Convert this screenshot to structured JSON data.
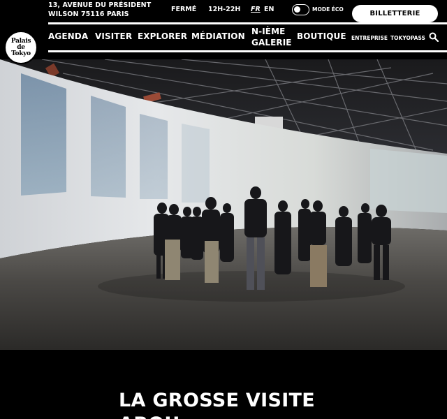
{
  "header": {
    "address": [
      "13, AVENUE DU PRÉSIDENT",
      "WILSON 75116 PARIS"
    ],
    "status": "FERMÉ",
    "hours": "12H-22H",
    "languages": [
      "FR",
      "EN"
    ],
    "active_language": "FR",
    "eco_mode_label": "MODE ÉCO",
    "ticket_label": "BILLETTERIE"
  },
  "logo": {
    "lines": [
      "Palais",
      "de",
      "Tokyo"
    ]
  },
  "nav": {
    "items": [
      "AGENDA",
      "VISITER",
      "EXPLORER",
      "MÉDIATION",
      "N-IÈME",
      "GALERIE",
      "BOUTIQUE"
    ],
    "secondary": [
      "ENTREPRISE",
      "TOKYOPASS"
    ]
  },
  "hero": {
    "title_lines": [
      "LA GROSSE VISITE",
      "ABOU"
    ]
  },
  "icons": {
    "search": "search-icon"
  },
  "colors": {
    "background": "#000000",
    "text": "#ffffff",
    "button": "#ffffff"
  }
}
